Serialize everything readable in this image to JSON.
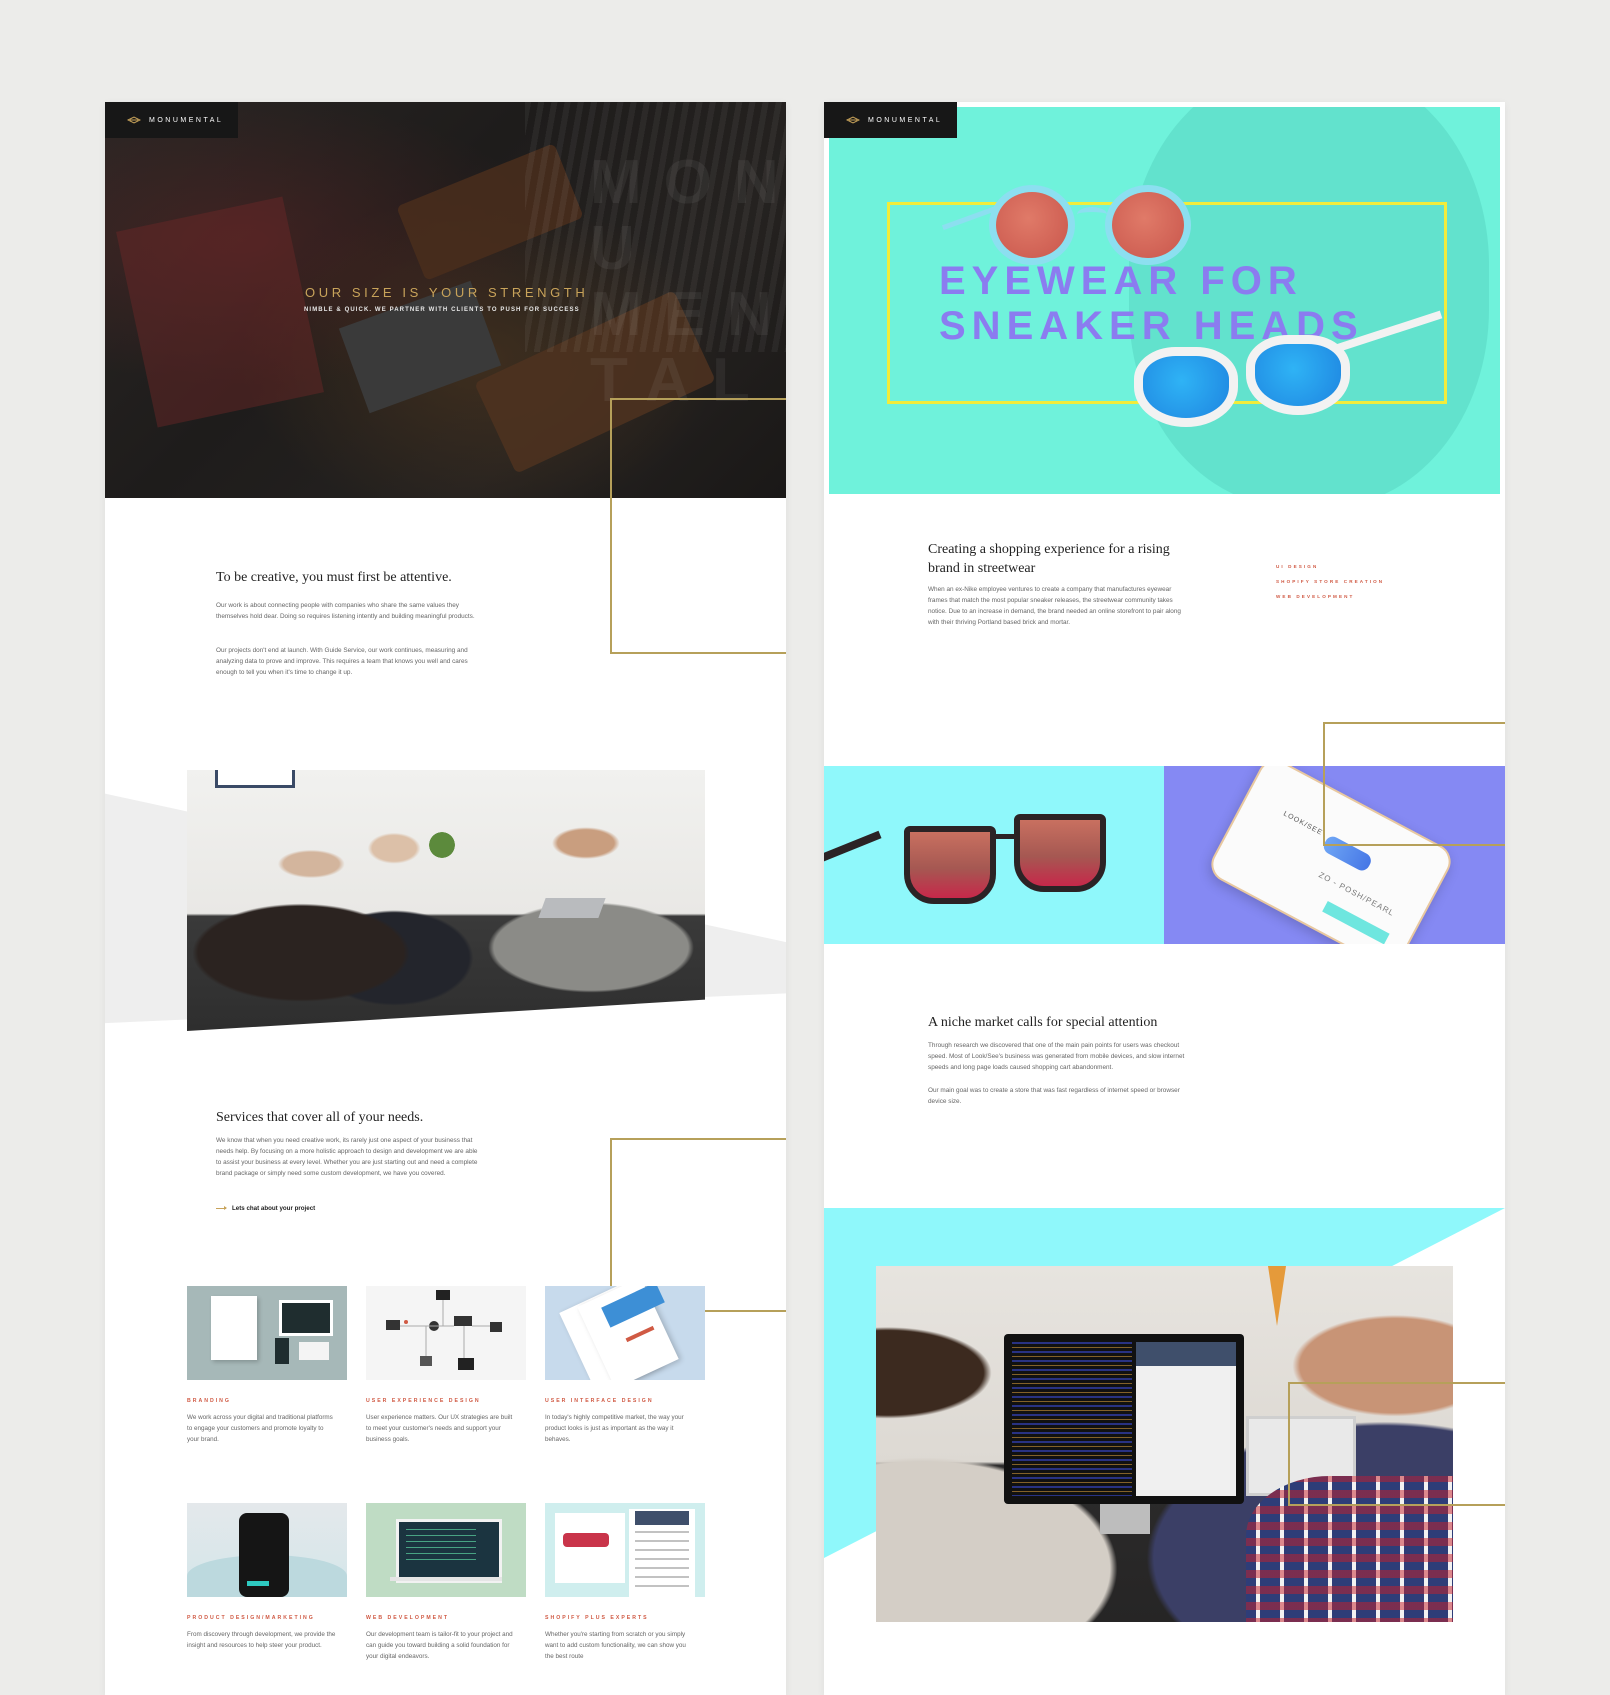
{
  "brand": {
    "logo_text": "MONUMENTAL"
  },
  "left": {
    "hero": {
      "title": "OUR SIZE IS YOUR STRENGTH",
      "subtitle": "NIMBLE & QUICK. WE PARTNER WITH CLIENTS TO PUSH FOR SUCCESS",
      "watermark": [
        "MON",
        "U",
        "MEN",
        "TAL"
      ]
    },
    "intro": {
      "title": "To be creative, you must first be attentive.",
      "p1": "Our work is about connecting people with companies who share the same values they themselves hold dear. Doing so requires listening intently and building meaningful products.",
      "p2": "Our projects don't end at launch. With Guide Service, our work continues, measuring and analyzing data to prove and improve. This requires a team that knows you well and cares enough to tell you when it's time to change it up."
    },
    "services": {
      "title": "Services that cover all of your needs.",
      "body": "We know that when you need creative work, its rarely just one aspect of your business that needs help. By focusing on a more holistic approach to design and development we are able to assist your business at every level. Whether you are just starting out and need a complete brand package or simply need some custom development, we have you covered.",
      "cta": "Lets chat about your project"
    },
    "cards": [
      {
        "title": "BRANDING",
        "desc": "We work across your digital and traditional platforms to engage your customers and promote loyalty to your brand."
      },
      {
        "title": "USER EXPERIENCE DESIGN",
        "desc": "User experience matters. Our UX strategies are built to meet your customer's needs and support your business goals."
      },
      {
        "title": "USER INTERFACE DESIGN",
        "desc": "In today's highly competitive market, the way your product looks is just as important as the way it behaves."
      },
      {
        "title": "PRODUCT DESIGN/MARKETING",
        "desc": "From discovery through development, we provide the insight and resources to help steer your product."
      },
      {
        "title": "WEB DEVELOPMENT",
        "desc": "Our development team is tailor-fit to your project and can guide you toward building a solid foundation for your digital endeavors."
      },
      {
        "title": "SHOPIFY PLUS EXPERTS",
        "desc": "Whether you're starting from scratch or you simply want to add custom functionality, we can show you the best route"
      }
    ]
  },
  "right": {
    "hero": {
      "line1": "EYEWEAR FOR",
      "line2": "SNEAKER HEADS"
    },
    "case": {
      "title": "Creating a shopping experience for a rising brand in streetwear",
      "body": "When an ex-Nike employee ventures to create a company that manufactures eyewear frames that match the most popular sneaker releases, the streetwear community takes notice. Due to an increase in demand, the brand needed an online storefront to pair along with their thriving Portland based brick and mortar.",
      "tags": [
        "UI DESIGN",
        "SHOPIFY STORE CREATION",
        "WEB DEVELOPMENT"
      ]
    },
    "phone": {
      "brand": "LOOK/SEE",
      "product": "ZO - POSH/PEARL"
    },
    "niche": {
      "title": "A niche market calls for special attention",
      "p1": "Through research we discovered that one of the main pain points for users was checkout speed. Most of Look/See's business was generated from mobile devices, and slow internet speeds and long page loads caused shopping cart abandonment.",
      "p2": "Our main goal was to create a store that was fast regardless of internet speed or browser device size."
    }
  },
  "colors": {
    "gold": "#b6a05a",
    "accent_red": "#d05a44",
    "cyan": "#8ff8fb",
    "mint": "#6ff2db",
    "violet": "#8b7cf0",
    "yellow": "#f1ec3b"
  }
}
